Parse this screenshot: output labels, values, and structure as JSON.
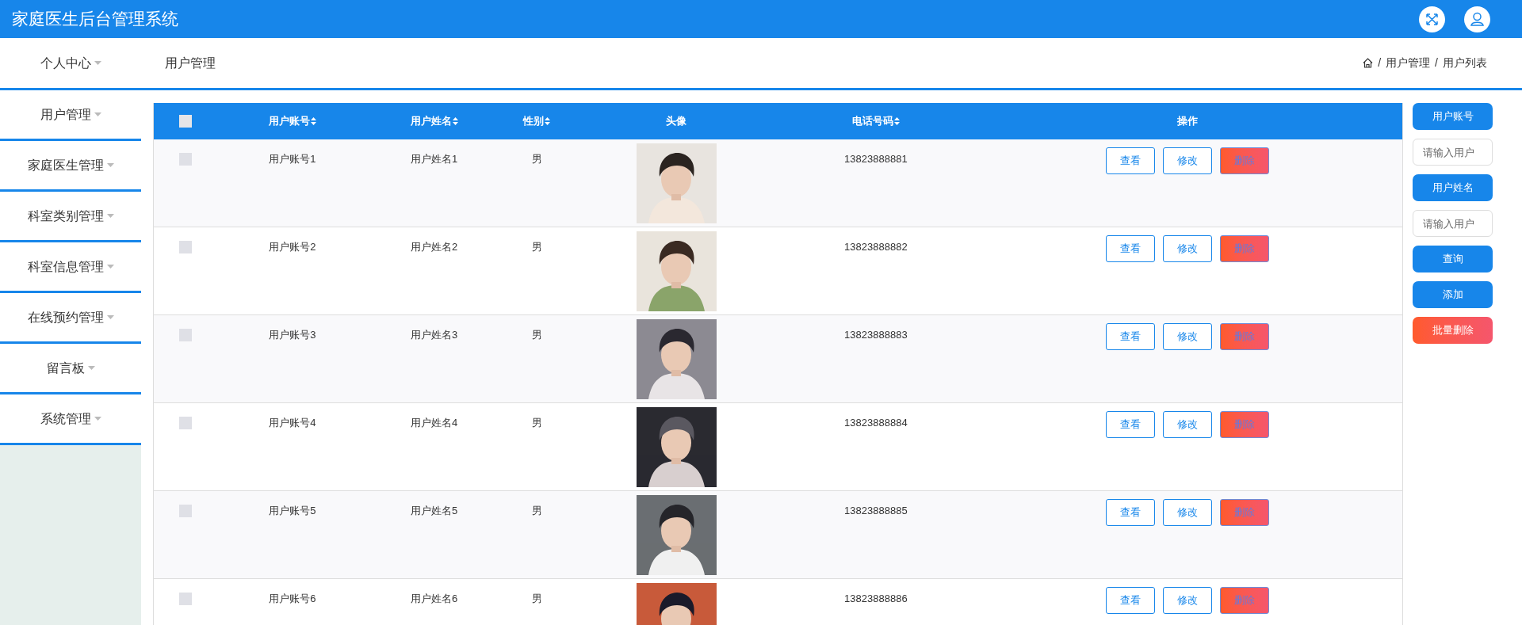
{
  "header": {
    "title": "家庭医生后台管理系统"
  },
  "top_bar": {
    "menu_item": "个人中心",
    "page_title": "用户管理",
    "breadcrumb": [
      {
        "separator": "/",
        "label": "用户管理"
      },
      {
        "separator": "/",
        "label": "用户列表"
      }
    ]
  },
  "sidebar": {
    "items": [
      "用户管理",
      "家庭医生管理",
      "科室类别管理",
      "科室信息管理",
      "在线预约管理",
      "留言板",
      "系统管理"
    ]
  },
  "table": {
    "all_selected": false,
    "columns": [
      {
        "label": "用户账号",
        "sortable": true
      },
      {
        "label": "用户姓名",
        "sortable": true
      },
      {
        "label": "性别",
        "sortable": true
      },
      {
        "label": "头像",
        "sortable": false
      },
      {
        "label": "电话号码",
        "sortable": true
      },
      {
        "label": "操作",
        "sortable": false
      }
    ],
    "rows": [
      {
        "selected": false,
        "account": "用户账号1",
        "name": "用户姓名1",
        "gender": "男",
        "phone": "13823888881",
        "actions": [
          {
            "label": "查看",
            "kind": "outline"
          },
          {
            "label": "修改",
            "kind": "outline"
          },
          {
            "label": "删除",
            "kind": "danger"
          }
        ]
      },
      {
        "selected": false,
        "account": "用户账号2",
        "name": "用户姓名2",
        "gender": "男",
        "phone": "13823888882",
        "actions": [
          {
            "label": "查看",
            "kind": "outline"
          },
          {
            "label": "修改",
            "kind": "outline"
          },
          {
            "label": "删除",
            "kind": "danger"
          }
        ]
      },
      {
        "selected": false,
        "account": "用户账号3",
        "name": "用户姓名3",
        "gender": "男",
        "phone": "13823888883",
        "actions": [
          {
            "label": "查看",
            "kind": "outline"
          },
          {
            "label": "修改",
            "kind": "outline"
          },
          {
            "label": "删除",
            "kind": "danger"
          }
        ]
      },
      {
        "selected": false,
        "account": "用户账号4",
        "name": "用户姓名4",
        "gender": "男",
        "phone": "13823888884",
        "actions": [
          {
            "label": "查看",
            "kind": "outline"
          },
          {
            "label": "修改",
            "kind": "outline"
          },
          {
            "label": "删除",
            "kind": "danger"
          }
        ]
      },
      {
        "selected": false,
        "account": "用户账号5",
        "name": "用户姓名5",
        "gender": "男",
        "phone": "13823888885",
        "actions": [
          {
            "label": "查看",
            "kind": "outline"
          },
          {
            "label": "修改",
            "kind": "outline"
          },
          {
            "label": "删除",
            "kind": "danger"
          }
        ]
      },
      {
        "selected": false,
        "account": "用户账号6",
        "name": "用户姓名6",
        "gender": "男",
        "phone": "13823888886",
        "actions": [
          {
            "label": "查看",
            "kind": "outline"
          },
          {
            "label": "修改",
            "kind": "outline"
          },
          {
            "label": "删除",
            "kind": "danger"
          }
        ]
      }
    ]
  },
  "search_panel": [
    {
      "kind": "label",
      "text": "用户账号"
    },
    {
      "kind": "field",
      "placeholder": "请输入用户"
    },
    {
      "kind": "label",
      "text": "用户姓名"
    },
    {
      "kind": "field",
      "placeholder": "请输入用户"
    },
    {
      "kind": "button",
      "text": "查询"
    },
    {
      "kind": "button",
      "text": "添加"
    },
    {
      "kind": "danger",
      "text": "批量删除"
    }
  ]
}
